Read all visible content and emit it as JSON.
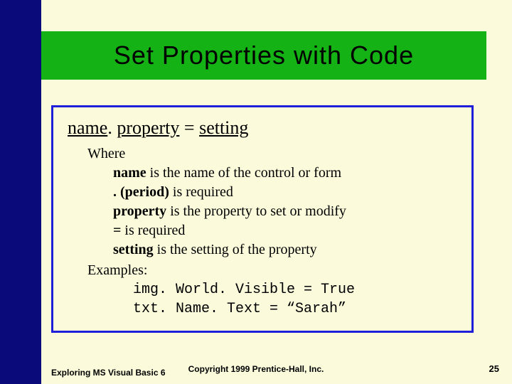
{
  "title": "Set Properties with Code",
  "syntax": {
    "name": "name",
    "dot": ".",
    "property": "property",
    "equals": " = ",
    "setting": "setting"
  },
  "where_heading": "Where",
  "definitions": [
    {
      "term": "name",
      "desc": " is the name of the control or form"
    },
    {
      "term": ". (period)",
      "desc": " is required"
    },
    {
      "term": "property",
      "desc": " is the property to set or modify"
    },
    {
      "term": "=",
      "desc": " is required"
    },
    {
      "term": "setting",
      "desc": " is the setting of the property"
    }
  ],
  "examples_heading": "Examples:",
  "examples": [
    "img. World. Visible = True",
    "txt. Name. Text = “Sarah”"
  ],
  "footer": {
    "left": "Exploring MS Visual Basic 6",
    "center": "Copyright 1999 Prentice-Hall, Inc.",
    "page": "25"
  }
}
